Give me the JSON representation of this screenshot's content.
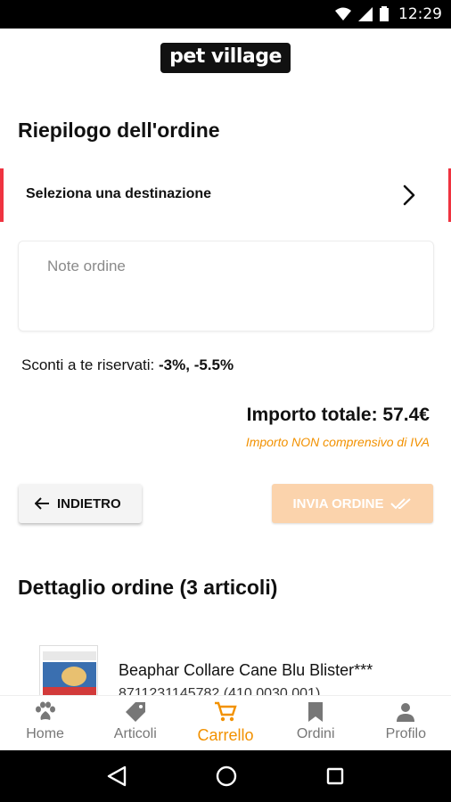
{
  "status_bar": {
    "time": "12:29"
  },
  "header": {
    "logo_text": "pet village"
  },
  "page": {
    "title": "Riepilogo dell'ordine",
    "destination_label": "Seleziona una destinazione",
    "notes_placeholder": "Note ordine",
    "discounts_label": "Sconti a te riservati:",
    "discounts_value": "-3%, -5.5%",
    "total_label": "Importo totale: 57.4€",
    "iva_note": "Importo NON comprensivo di IVA",
    "back_button": "INDIETRO",
    "send_button": "INVIA ORDINE",
    "detail_title": "Dettaglio ordine (3 articoli)"
  },
  "products": [
    {
      "name": "Beaphar Collare Cane Blu Blister***",
      "code": "8711231145782 (410.0030.001)"
    }
  ],
  "bottom_nav": [
    {
      "label": "Home",
      "icon": "paw-icon",
      "active": false
    },
    {
      "label": "Articoli",
      "icon": "tag-icon",
      "active": false
    },
    {
      "label": "Carrello",
      "icon": "cart-icon",
      "active": true
    },
    {
      "label": "Ordini",
      "icon": "bookmark-icon",
      "active": false
    },
    {
      "label": "Profilo",
      "icon": "person-icon",
      "active": false
    }
  ],
  "colors": {
    "accent": "#f29100",
    "send_button_bg": "#fbd3ac",
    "alert_red": "#ef3340"
  }
}
